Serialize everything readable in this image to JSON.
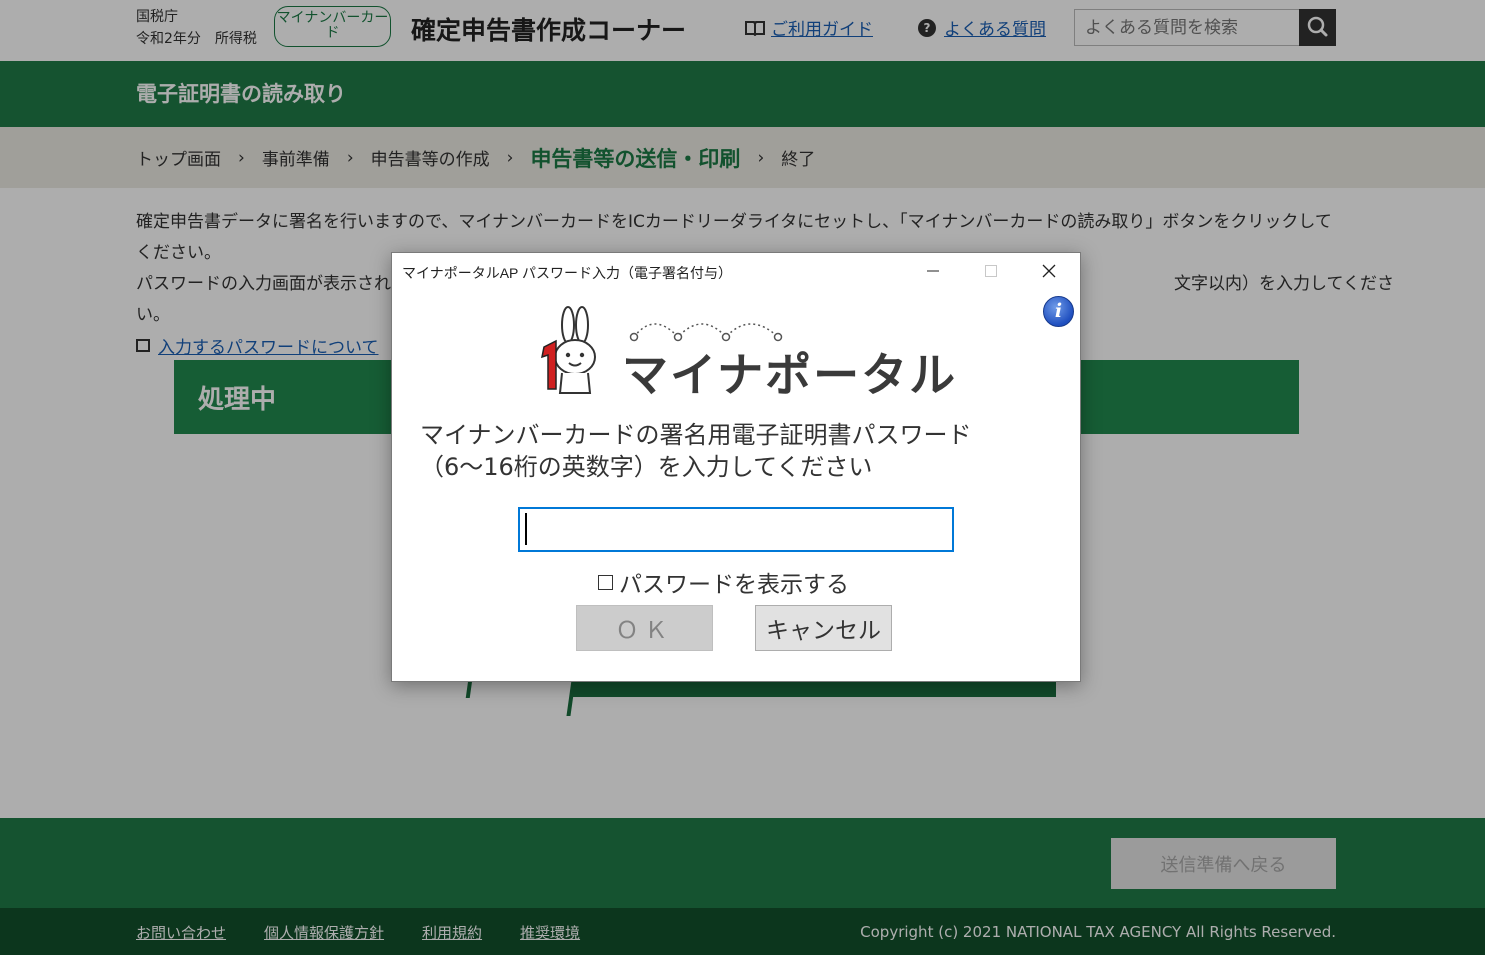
{
  "header": {
    "agency": "国税庁",
    "year_tax": "令和2年分　所得税",
    "mynumber_badge": "マイナンバーカード",
    "site_title": "確定申告書作成コーナー",
    "guide_link": "ご利用ガイド",
    "faq_link": "よくある質問",
    "search_placeholder": "よくある質問を検索"
  },
  "page_title": "電子証明書の読み取り",
  "breadcrumb": {
    "items": [
      "トップ画面",
      "事前準備",
      "申告書等の作成",
      "申告書等の送信・印刷",
      "終了"
    ],
    "current_index": 3
  },
  "main": {
    "instruction_line1": "確定申告書データに署名を行いますので、マイナンバーカードをICカードリーダライタにセットし、「マイナンバーカードの読み取り」ボタンをクリックしてください。",
    "instruction_line2_left": "パスワードの入力画面が表示され",
    "instruction_line2_right": "文字以内）を入力してくださ",
    "instruction_line3": "い。",
    "password_link": "入力するパスワードについて",
    "processing_title": "処理中"
  },
  "footer": {
    "back_button": "送信準備へ戻る",
    "links": [
      "お問い合わせ",
      "個人情報保護方針",
      "利用規約",
      "推奨環境"
    ],
    "copyright": "Copyright (c) 2021 NATIONAL TAX AGENCY All Rights Reserved."
  },
  "dialog": {
    "window_title": "マイナポータルAP パスワード入力（電子署名付与）",
    "logo_text": "マイナポータル",
    "prompt_line1": "マイナンバーカードの署名用電子証明書パスワード",
    "prompt_line2": "（6～16桁の英数字）を入力してください",
    "password_value": "",
    "show_password_label": "パスワードを表示する",
    "show_password_checked": false,
    "ok_label": "ＯＫ",
    "cancel_label": "キャンセル"
  },
  "colors": {
    "brand_green": "#1f7b48",
    "dark_green": "#12502c",
    "link_blue": "#1a5fb4",
    "focus_blue": "#0078d7"
  }
}
